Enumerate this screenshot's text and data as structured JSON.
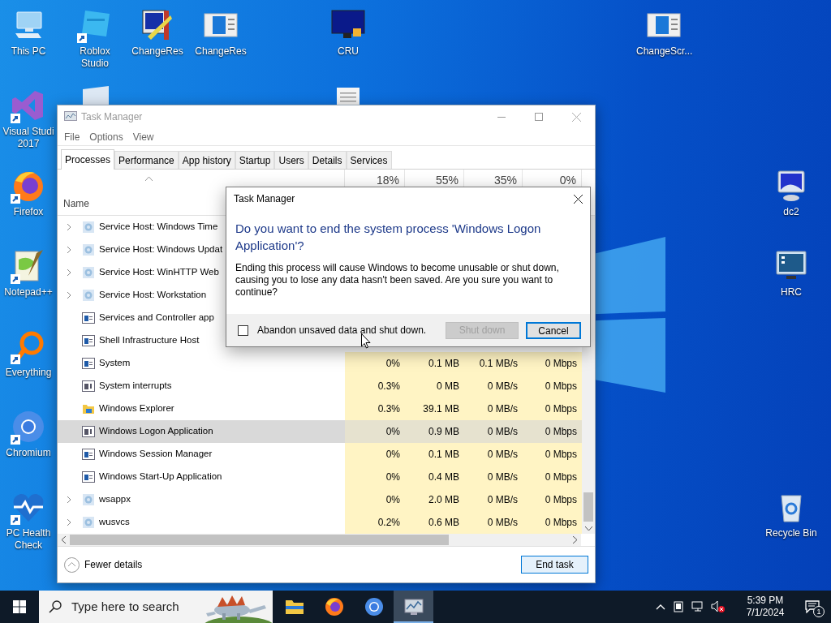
{
  "desktop_icons": [
    {
      "label": "This PC",
      "kind": "pc",
      "shortcut": false
    },
    {
      "label": "Roblox Studio",
      "kind": "roblox",
      "shortcut": true
    },
    {
      "label": "ChangeRes",
      "kind": "changeres",
      "shortcut": false
    },
    {
      "label": "ChangeRes",
      "kind": "docwindow",
      "shortcut": false
    },
    {
      "label": "CRU",
      "kind": "cru",
      "shortcut": false
    },
    {
      "label": "ChangeScr...",
      "kind": "docwindow",
      "shortcut": false
    },
    {
      "label": "Visual Studi 2017",
      "kind": "vs",
      "shortcut": true
    },
    {
      "label": "Firefox",
      "kind": "firefox",
      "shortcut": true
    },
    {
      "label": "Notepad++",
      "kind": "notepad",
      "shortcut": true
    },
    {
      "label": "Everything",
      "kind": "everything",
      "shortcut": true
    },
    {
      "label": "Chromium",
      "kind": "chromium",
      "shortcut": true
    },
    {
      "label": "PC Health Check",
      "kind": "health",
      "shortcut": true
    },
    {
      "label": "dc2",
      "kind": "monitor",
      "shortcut": false
    },
    {
      "label": "HRC",
      "kind": "hrc",
      "shortcut": false
    },
    {
      "label": "Recycle Bin",
      "kind": "recycle",
      "shortcut": false
    }
  ],
  "task_manager": {
    "title": "Task Manager",
    "menu": [
      "File",
      "Options",
      "View"
    ],
    "tabs": [
      {
        "label": "Processes",
        "selected": true
      },
      {
        "label": "Performance",
        "selected": false
      },
      {
        "label": "App history",
        "selected": false
      },
      {
        "label": "Startup",
        "selected": false
      },
      {
        "label": "Users",
        "selected": false
      },
      {
        "label": "Details",
        "selected": false
      },
      {
        "label": "Services",
        "selected": false
      }
    ],
    "name_header": "Name",
    "usage_headers": [
      "18%",
      "55%",
      "35%",
      "0%"
    ],
    "rows": [
      {
        "name": "Service Host: Windows Time",
        "kind": "gear",
        "expandable": true,
        "selected": false
      },
      {
        "name": "Service Host: Windows Updat",
        "kind": "gear",
        "expandable": true,
        "selected": false
      },
      {
        "name": "Service Host: WinHTTP Web",
        "kind": "gear",
        "expandable": true,
        "selected": false
      },
      {
        "name": "Service Host: Workstation",
        "kind": "gear",
        "expandable": true,
        "selected": false
      },
      {
        "name": "Services and Controller app",
        "kind": "window",
        "expandable": false,
        "selected": false
      },
      {
        "name": "Shell Infrastructure Host",
        "kind": "window",
        "expandable": false,
        "selected": false
      },
      {
        "name": "System",
        "kind": "window",
        "expandable": false,
        "selected": false,
        "cpu": "0%",
        "memory": "0.1 MB",
        "disk": "0.1 MB/s",
        "network": "0 Mbps"
      },
      {
        "name": "System interrupts",
        "kind": "interrupts",
        "expandable": false,
        "selected": false,
        "cpu": "0.3%",
        "memory": "0 MB",
        "disk": "0 MB/s",
        "network": "0 Mbps"
      },
      {
        "name": "Windows Explorer",
        "kind": "folder",
        "expandable": false,
        "selected": false,
        "cpu": "0.3%",
        "memory": "39.1 MB",
        "disk": "0 MB/s",
        "network": "0 Mbps"
      },
      {
        "name": "Windows Logon Application",
        "kind": "interrupts",
        "expandable": false,
        "selected": true,
        "cpu": "0%",
        "memory": "0.9 MB",
        "disk": "0 MB/s",
        "network": "0 Mbps"
      },
      {
        "name": "Windows Session Manager",
        "kind": "window",
        "expandable": false,
        "selected": false,
        "cpu": "0%",
        "memory": "0.1 MB",
        "disk": "0 MB/s",
        "network": "0 Mbps"
      },
      {
        "name": "Windows Start-Up Application",
        "kind": "window",
        "expandable": false,
        "selected": false,
        "cpu": "0%",
        "memory": "0.4 MB",
        "disk": "0 MB/s",
        "network": "0 Mbps"
      },
      {
        "name": "wsappx",
        "kind": "gear",
        "expandable": true,
        "selected": false,
        "cpu": "0%",
        "memory": "2.0 MB",
        "disk": "0 MB/s",
        "network": "0 Mbps"
      },
      {
        "name": "wusvcs",
        "kind": "gear",
        "expandable": true,
        "selected": false,
        "cpu": "0.2%",
        "memory": "0.6 MB",
        "disk": "0 MB/s",
        "network": "0 Mbps"
      }
    ],
    "fewer_details": "Fewer details",
    "end_task": "End task"
  },
  "dialog": {
    "title": "Task Manager",
    "heading": "Do you want to end the system process 'Windows Logon Application'?",
    "message": "Ending this process will cause Windows to become unusable or shut down, causing you to lose any data hasn't been saved. Are you sure you want to continue?",
    "checkbox": {
      "label": "Abandon unsaved data and shut down.",
      "checked": false
    },
    "buttons": [
      {
        "label": "Shut down",
        "disabled": true
      },
      {
        "label": "Cancel",
        "disabled": false
      }
    ]
  },
  "taskbar": {
    "search_placeholder": "Type here to search",
    "apps": [
      {
        "kind": "explorer",
        "selected": false
      },
      {
        "kind": "firefox",
        "selected": false
      },
      {
        "kind": "chromium",
        "selected": false
      },
      {
        "kind": "taskmanager",
        "selected": true
      }
    ],
    "time": "5:39 PM",
    "date": "7/1/2024",
    "notifications": "1"
  }
}
